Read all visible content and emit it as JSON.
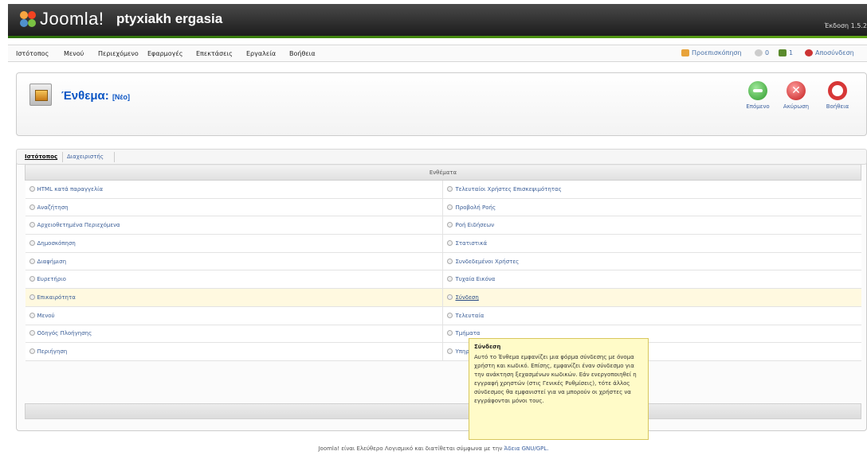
{
  "header": {
    "logo_text": "Joomla!",
    "site_name": "ptyxiakh ergasia",
    "version": "Έκδοση 1.5.2"
  },
  "menubar": {
    "items": [
      "Ιστότοπος",
      "Μενού",
      "Περιεχόμενο",
      "Εφαρμογές",
      "Επεκτάσεις",
      "Εργαλεία",
      "Βοήθεια"
    ],
    "preview": "Προεπισκόπηση",
    "messages_count": "0",
    "users_count": "1",
    "logout": "Αποσύνδεση",
    "colors": {
      "preview": "#e8a33a",
      "messages": "#cccccc",
      "users": "#5a8a2c",
      "logout": "#cc3333"
    }
  },
  "toolbar": {
    "title": "Ένθεμα:",
    "title_suffix": "[Νέο]",
    "next_label": "Επόμενο",
    "cancel_label": "Ακύρωση",
    "help_label": "Βοήθεια",
    "cancel_glyph": "✕"
  },
  "tabs": {
    "active": "Ιστότοπος",
    "inactive": "Διαχειριστής"
  },
  "table": {
    "header": "Ενθέματα",
    "rows": [
      {
        "left": "HTML κατά παραγγελία",
        "right": "Τελευταίοι Χρήστες Επισκεψιμότητας"
      },
      {
        "left": "Αναζήτηση",
        "right": "Προβολή Ροής"
      },
      {
        "left": "Αρχειοθετημένα Περιεχόμενα",
        "right": "Ροή Ειδήσεων"
      },
      {
        "left": "Δημοσκόπηση",
        "right": "Στατιστικά"
      },
      {
        "left": "Διαφήμιση",
        "right": "Συνδεδεμένοι Χρήστες"
      },
      {
        "left": "Ευρετήριο",
        "right": "Τυχαία Εικόνα"
      },
      {
        "left": "Επικαιρότητα",
        "right": "Σύνδεση"
      },
      {
        "left": "Μενού",
        "right": "Τελευταία"
      },
      {
        "left": "Οδηγός Πλοήγησης",
        "right": "Τμήματα"
      },
      {
        "left": "Περιήγηση",
        "right": "Υπηρεσίες"
      }
    ],
    "highlight_row": 6
  },
  "tooltip": {
    "title": "Σύνδεση",
    "body": "Αυτό το Ένθεμα εμφανίζει μια φόρμα σύνδεσης με όνομα χρήστη και κωδικό. Επίσης, εμφανίζει έναν σύνδεσμο για την ανάκτηση ξεχασμένων κωδικών. Εάν ενεργοποιηθεί η εγγραφή χρηστών (στις Γενικές Ρυθμίσεις), τότε άλλος σύνδεσμος θα εμφανιστεί για να μπορούν οι χρήστες να εγγράφονται μόνοι τους."
  },
  "footer": {
    "text": "Joomla! είναι Ελεύθερο Λογισμικό και διατίθεται σύμφωνα με την",
    "license_link": "Άδεια GNU/GPL."
  }
}
